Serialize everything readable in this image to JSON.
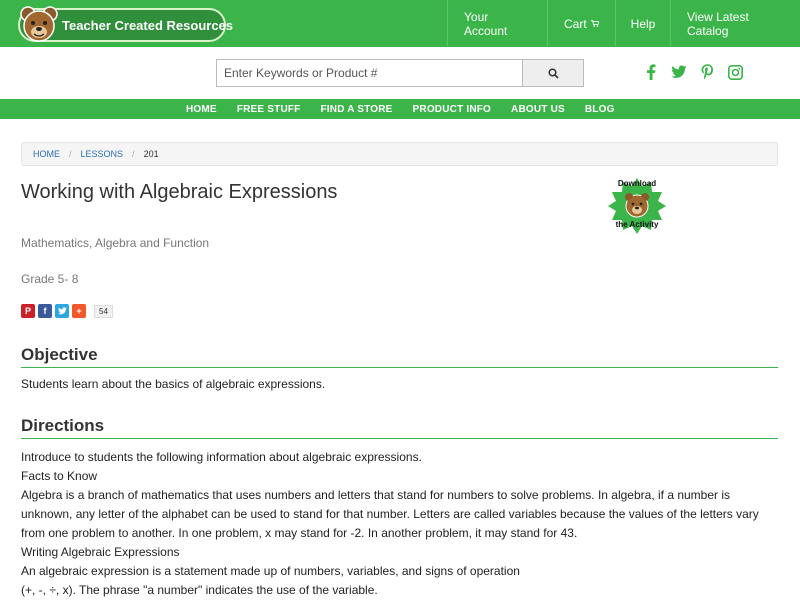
{
  "header": {
    "logo_text": "Teacher Created Resources",
    "nav": [
      "Your Account",
      "Cart",
      "Help",
      "View Latest Catalog"
    ]
  },
  "search": {
    "placeholder": "Enter Keywords or Product #"
  },
  "social_icons": [
    "facebook-icon",
    "twitter-icon",
    "pinterest-icon",
    "instagram-icon"
  ],
  "main_nav": [
    "HOME",
    "FREE STUFF",
    "FIND A STORE",
    "PRODUCT INFO",
    "ABOUT US",
    "BLOG"
  ],
  "breadcrumb": {
    "home": "HOME",
    "lessons": "LESSONS",
    "current": "201"
  },
  "lesson": {
    "title": "Working with Algebraic Expressions",
    "subject": "Mathematics, Algebra and Function",
    "grade": "Grade 5- 8",
    "download_line1": "Download",
    "download_line2": "the Activity",
    "share_count": "54"
  },
  "objective": {
    "heading": "Objective",
    "text": "Students learn about the basics of algebraic expressions."
  },
  "directions": {
    "heading": "Directions",
    "lines": [
      "Introduce to students the following information about algebraic expressions.",
      "Facts to Know",
      "Algebra is a branch of mathematics that uses numbers and letters that stand for numbers to solve problems. In algebra, if a number is unknown, any letter of the alphabet can be used to stand for that number. Letters are called variables because the values of the letters vary from one problem to another. In one problem, x may stand for -2. In another problem, it may stand for 43.",
      "Writing Algebraic Expressions",
      "An algebraic expression is a statement made up of numbers, variables, and signs of operation",
      "(+, -, ÷, x). The phrase \"a number\" indicates the use of the variable."
    ]
  },
  "colors": {
    "brand_green": "#3bb54a",
    "link_blue": "#2a6db5"
  }
}
